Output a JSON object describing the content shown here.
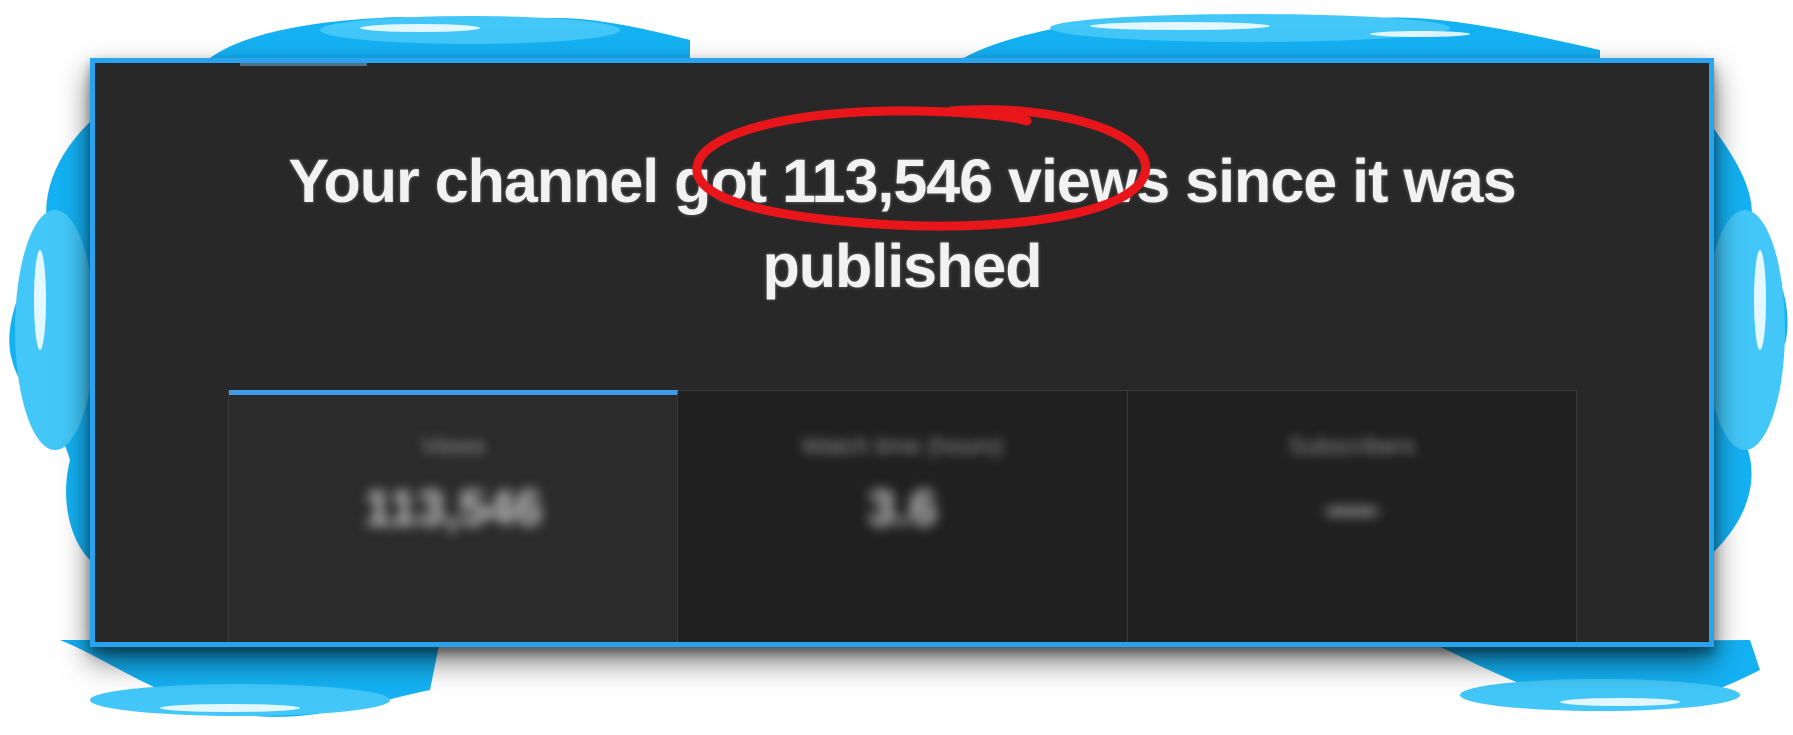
{
  "headline": {
    "before": "Your channel got ",
    "highlight": "113,546 views",
    "after": " since it was",
    "line2": "published"
  },
  "stats": [
    {
      "label": "Views",
      "value": "113,546",
      "selected": true
    },
    {
      "label": "Watch time (hours)",
      "value": "3.6",
      "selected": false
    },
    {
      "label": "Subscribers",
      "value": "—",
      "selected": false
    }
  ],
  "colors": {
    "frame": "#29a3f0",
    "panel": "#282828",
    "annotation": "#e8151b",
    "tab_indicator": "#3d9be9",
    "text": "#f2f2f2"
  }
}
